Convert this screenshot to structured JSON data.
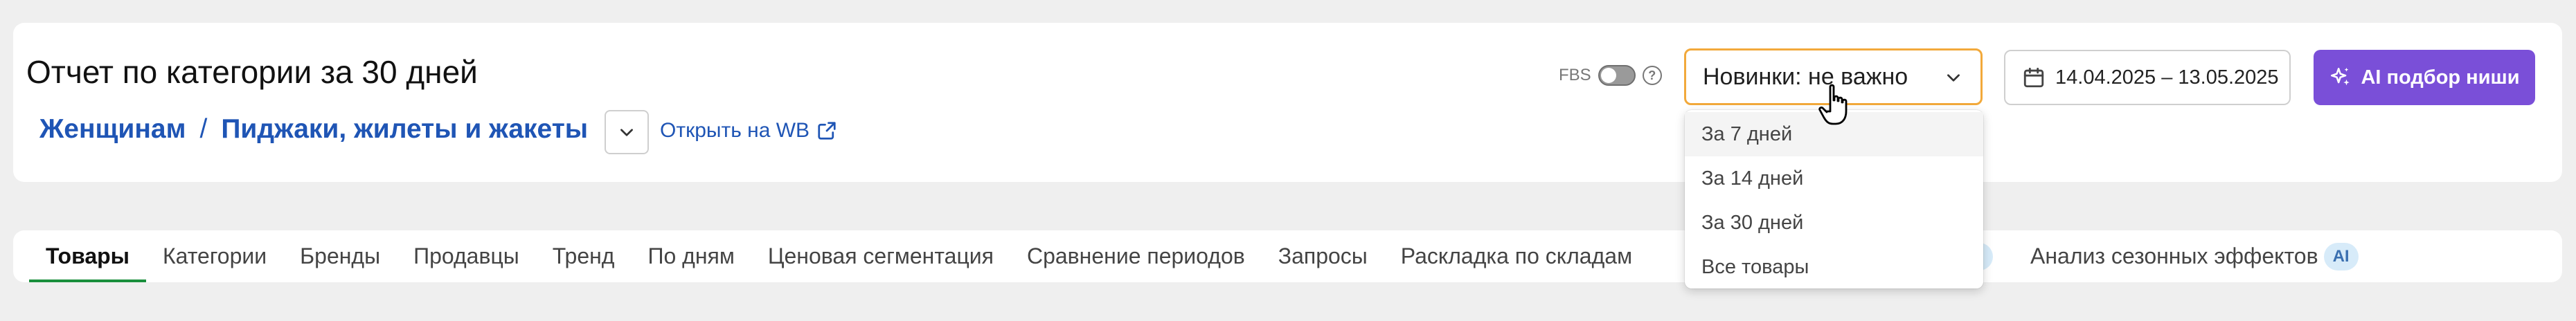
{
  "header": {
    "title": "Отчет по категории за 30 дней",
    "breadcrumb": [
      "Женщинам",
      "Пиджаки, жилеты и жакеты"
    ],
    "breadcrumb_separator": "/",
    "open_link": "Открыть на WB",
    "fbs_label": "FBS",
    "fbs_enabled": false
  },
  "novelty_select": {
    "value": "Новинки: не важно",
    "options": [
      "За 7 дней",
      "За 14 дней",
      "За 30 дней",
      "Все товары"
    ],
    "hovered_index": 0
  },
  "date_range": "14.04.2025 – 13.05.2025",
  "ai_button": "AI подбор ниши",
  "tabs": {
    "items": [
      "Товары",
      "Категории",
      "Бренды",
      "Продавцы",
      "Тренд",
      "По дням",
      "Ценовая сегментация",
      "Сравнение периодов",
      "Запросы",
      "Раскладка по складам"
    ],
    "active_index": 0,
    "partial_badge": "AI",
    "seasonal": "Анализ сезонных эффектов",
    "seasonal_badge": "AI"
  },
  "colors": {
    "accent_purple": "#7a4fd8",
    "link_blue": "#1f55b5",
    "select_border": "#f2a93b",
    "active_tab_underline": "#1a8f3c"
  }
}
